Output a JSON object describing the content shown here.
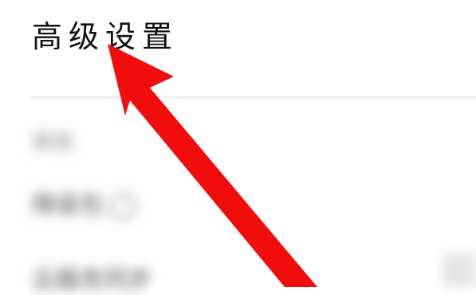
{
  "header": {
    "title": "高级设置"
  },
  "settings": {
    "section_label": "其他",
    "items": [
      {
        "label": "降级包"
      },
      {
        "label": "云服务同步"
      }
    ]
  },
  "annotation": {
    "arrow_color": "#f20d0d",
    "arrow_target": "page-title"
  }
}
